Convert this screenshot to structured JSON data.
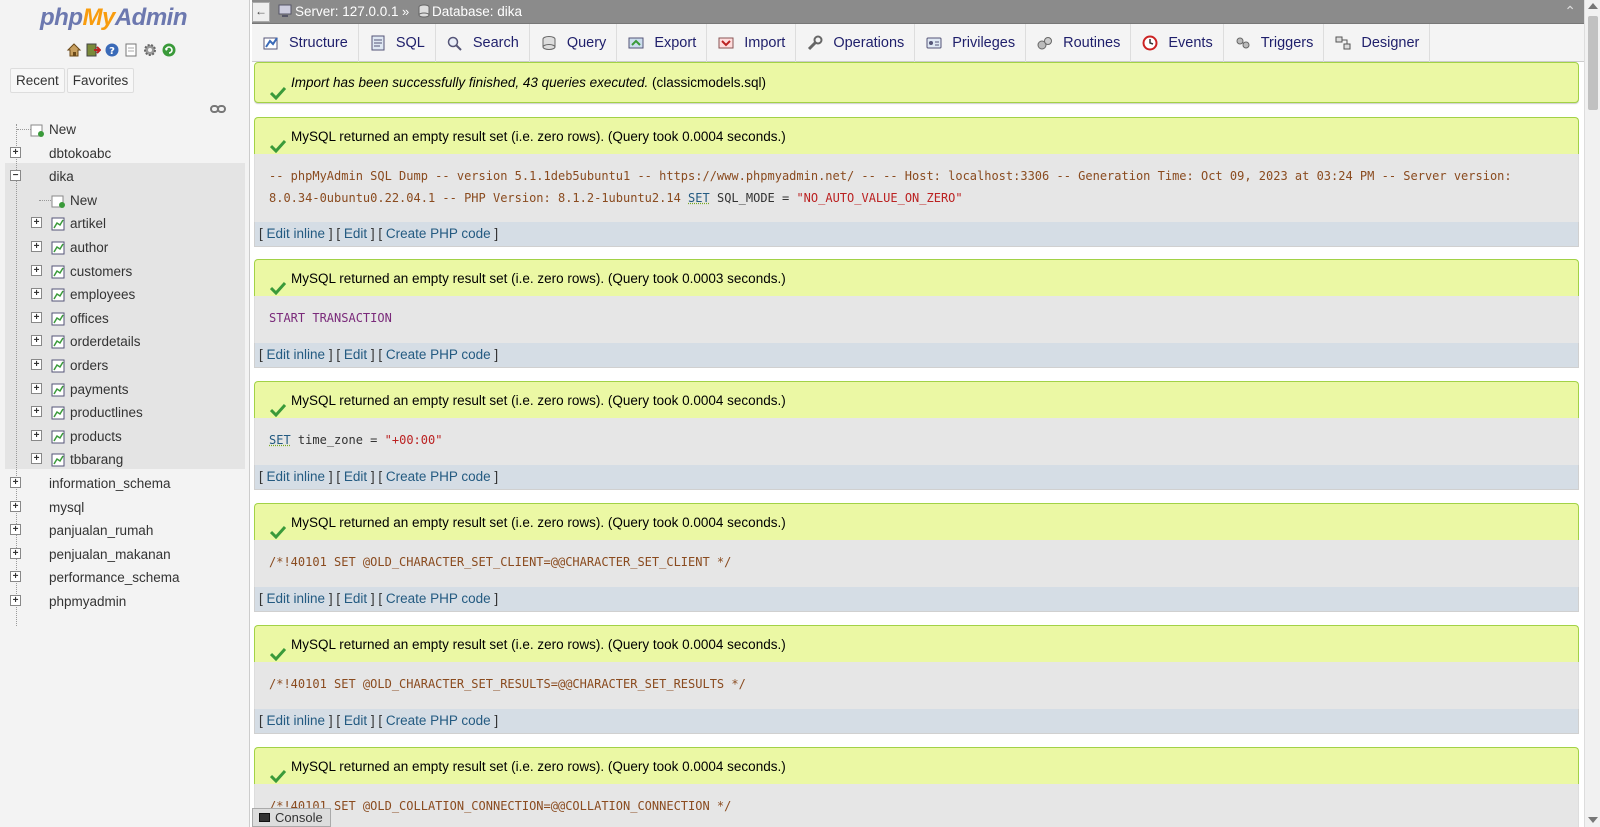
{
  "logo": {
    "php": "php",
    "my": "My",
    "admin": "Admin"
  },
  "nav": {
    "icons": [
      "home-icon",
      "exit-icon",
      "help-icon",
      "docs-icon",
      "settings-icon",
      "reload-icon"
    ],
    "tabs": {
      "recent": "Recent",
      "favorites": "Favorites"
    },
    "tree": {
      "new": "New",
      "dbs_before": [
        "dbtokoabc"
      ],
      "selected_db": "dika",
      "selected_new": "New",
      "tables": [
        "artikel",
        "author",
        "customers",
        "employees",
        "offices",
        "orderdetails",
        "orders",
        "payments",
        "productlines",
        "products",
        "tbbarang"
      ],
      "dbs_after": [
        "information_schema",
        "mysql",
        "panjualan_rumah",
        "penjualan_makanan",
        "performance_schema",
        "phpmyadmin"
      ]
    }
  },
  "breadcrumb": {
    "server": "Server: 127.0.0.1",
    "sep": "»",
    "database": "Database: dika"
  },
  "tabs": [
    {
      "label": "Structure",
      "icon": "structure-icon"
    },
    {
      "label": "SQL",
      "icon": "sql-icon"
    },
    {
      "label": "Search",
      "icon": "search-icon"
    },
    {
      "label": "Query",
      "icon": "query-icon"
    },
    {
      "label": "Export",
      "icon": "export-icon"
    },
    {
      "label": "Import",
      "icon": "import-icon"
    },
    {
      "label": "Operations",
      "icon": "operations-icon"
    },
    {
      "label": "Privileges",
      "icon": "privileges-icon"
    },
    {
      "label": "Routines",
      "icon": "routines-icon"
    },
    {
      "label": "Events",
      "icon": "events-icon"
    },
    {
      "label": "Triggers",
      "icon": "triggers-icon"
    },
    {
      "label": "Designer",
      "icon": "designer-icon"
    }
  ],
  "import_message": {
    "italic": "Import has been successfully finished, 43 queries executed.",
    "file": "(classicmodels.sql)"
  },
  "result_message": "MySQL returned an empty result set (i.e. zero rows). (Query took 0.0004 seconds.)",
  "result_message_2": "MySQL returned an empty result set (i.e. zero rows). (Query took 0.0003 seconds.)",
  "tools": {
    "edit_inline": "Edit inline",
    "edit": "Edit",
    "create_php": "Create PHP code"
  },
  "queries": {
    "q1_comment": "-- phpMyAdmin SQL Dump -- version 5.1.1deb5ubuntu1 -- https://www.phpmyadmin.net/ -- -- Host: localhost:3306 -- Generation Time: Oct 09, 2023 at 03:24 PM -- Server version:",
    "q1_line2": "8.0.34-0ubuntu0.22.04.1 -- PHP Version: 8.1.2-1ubuntu2.14",
    "q1_kw": "SET",
    "q1_rest": "SQL_MODE =",
    "q1_str": "\"NO_AUTO_VALUE_ON_ZERO\"",
    "q2": "START TRANSACTION",
    "q3_kw": "SET",
    "q3_rest": "time_zone =",
    "q3_str": "\"+00:00\"",
    "q4": "/*!40101 SET @OLD_CHARACTER_SET_CLIENT=@@CHARACTER_SET_CLIENT */",
    "q5": "/*!40101 SET @OLD_CHARACTER_SET_RESULTS=@@CHARACTER_SET_RESULTS */",
    "q6": "/*!40101 SET @OLD_COLLATION_CONNECTION=@@COLLATION_CONNECTION */"
  },
  "console": "Console"
}
